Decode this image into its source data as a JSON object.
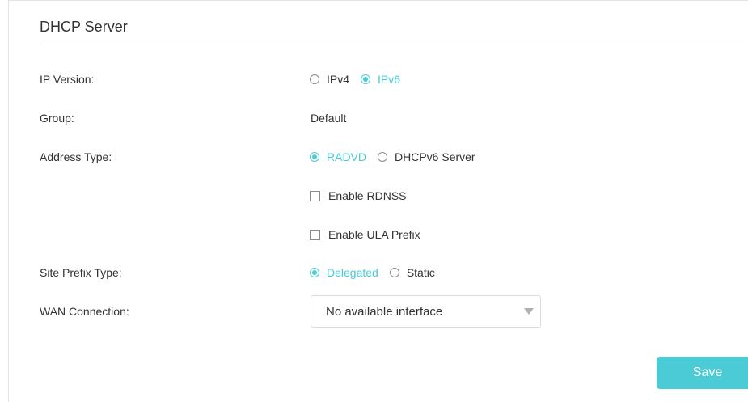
{
  "section": {
    "title": "DHCP Server"
  },
  "ip_version": {
    "label": "IP Version:",
    "options": [
      {
        "text": "IPv4",
        "selected": false
      },
      {
        "text": "IPv6",
        "selected": true
      }
    ]
  },
  "group": {
    "label": "Group:",
    "value": "Default"
  },
  "address_type": {
    "label": "Address Type:",
    "options": [
      {
        "text": "RADVD",
        "selected": true
      },
      {
        "text": "DHCPv6 Server",
        "selected": false
      }
    ]
  },
  "enable_rdnss": {
    "text": "Enable RDNSS",
    "checked": false
  },
  "enable_ula_prefix": {
    "text": "Enable ULA Prefix",
    "checked": false
  },
  "site_prefix_type": {
    "label": "Site Prefix Type:",
    "options": [
      {
        "text": "Delegated",
        "selected": true
      },
      {
        "text": "Static",
        "selected": false
      }
    ]
  },
  "wan_connection": {
    "label": "WAN Connection:",
    "value": "No available interface"
  },
  "save_button": {
    "text": "Save"
  },
  "colors": {
    "accent": "#4acbd6",
    "text": "#333333",
    "border": "#dcdcdc"
  },
  "icons": {
    "select_caret": "caret-down-icon"
  }
}
